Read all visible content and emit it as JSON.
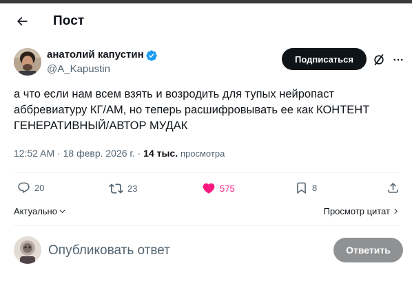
{
  "header": {
    "title": "Пост"
  },
  "author": {
    "name": "анатолий капустин",
    "handle": "@A_Kapustin",
    "subscribe_label": "Подписаться"
  },
  "tweet": {
    "lines": [
      "а что если нам всем взять и возродить для тупых нейропаст",
      "аббревиатуру КГ/АМ, но теперь расшифровывать ее как КОНТЕНТ",
      "ГЕНЕРАТИВНЫЙ/АВТОР МУДАК"
    ],
    "time": "12:52 AM",
    "date": "18 февр. 2026 г.",
    "views_count": "14 тыс.",
    "views_label": "просмотра"
  },
  "actions": {
    "replies": "20",
    "reposts": "23",
    "likes": "575",
    "bookmarks": "8"
  },
  "filters": {
    "sort_label": "Актуально",
    "quotes_label": "Просмотр цитат"
  },
  "reply": {
    "placeholder": "Опубликовать ответ",
    "button_label": "Ответить"
  },
  "colors": {
    "accent_blue": "#1d9bf0",
    "like_pink": "#f91880",
    "muted": "#536471",
    "text": "#0f1419"
  }
}
